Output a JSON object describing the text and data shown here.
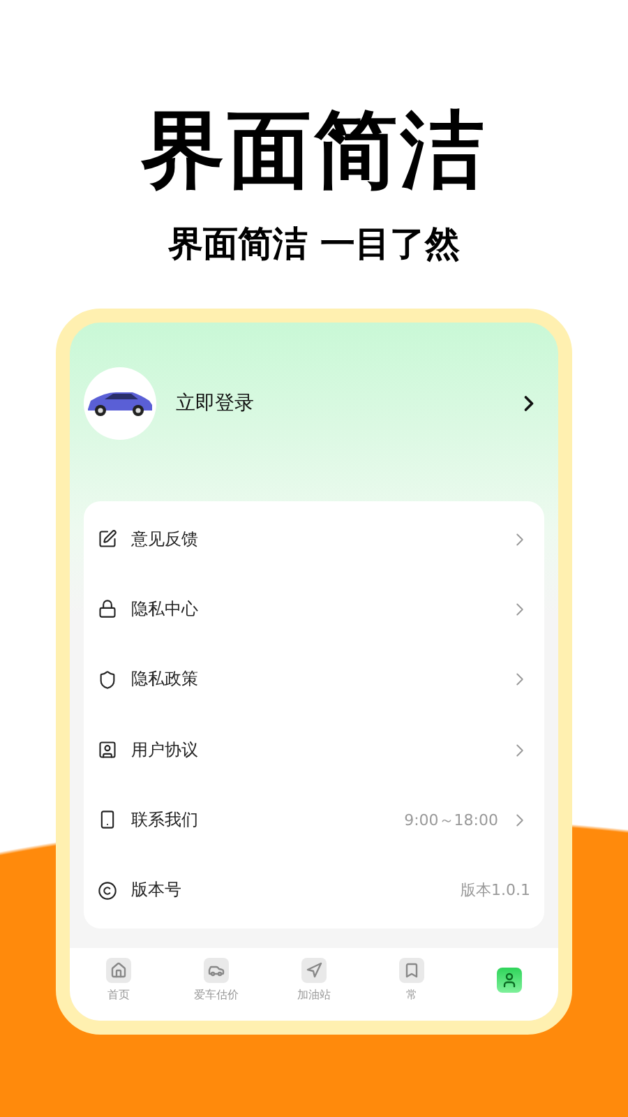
{
  "headline": "界面简洁",
  "subtitle": "界面简洁 一目了然",
  "profile": {
    "login_label": "立即登录"
  },
  "menu": [
    {
      "kind": "feedback",
      "label": "意见反馈",
      "arrow": true
    },
    {
      "kind": "lock",
      "label": "隐私中心",
      "arrow": true
    },
    {
      "kind": "shield",
      "label": "隐私政策",
      "arrow": true
    },
    {
      "kind": "agreement",
      "label": "用户协议",
      "arrow": true
    },
    {
      "kind": "phone",
      "label": "联系我们",
      "value": "9:00～18:00",
      "arrow": true
    },
    {
      "kind": "copyright",
      "label": "版本号",
      "value": "版本1.0.1",
      "arrow": false
    }
  ],
  "tab_bar": [
    {
      "kind": "home",
      "label": "首页",
      "selected": false
    },
    {
      "kind": "car",
      "label": "爱车估价",
      "selected": false
    },
    {
      "kind": "navigate",
      "label": "加油站",
      "selected": false
    },
    {
      "kind": "flag",
      "label": "常",
      "selected": false
    },
    {
      "kind": "mine",
      "selected": true
    }
  ]
}
